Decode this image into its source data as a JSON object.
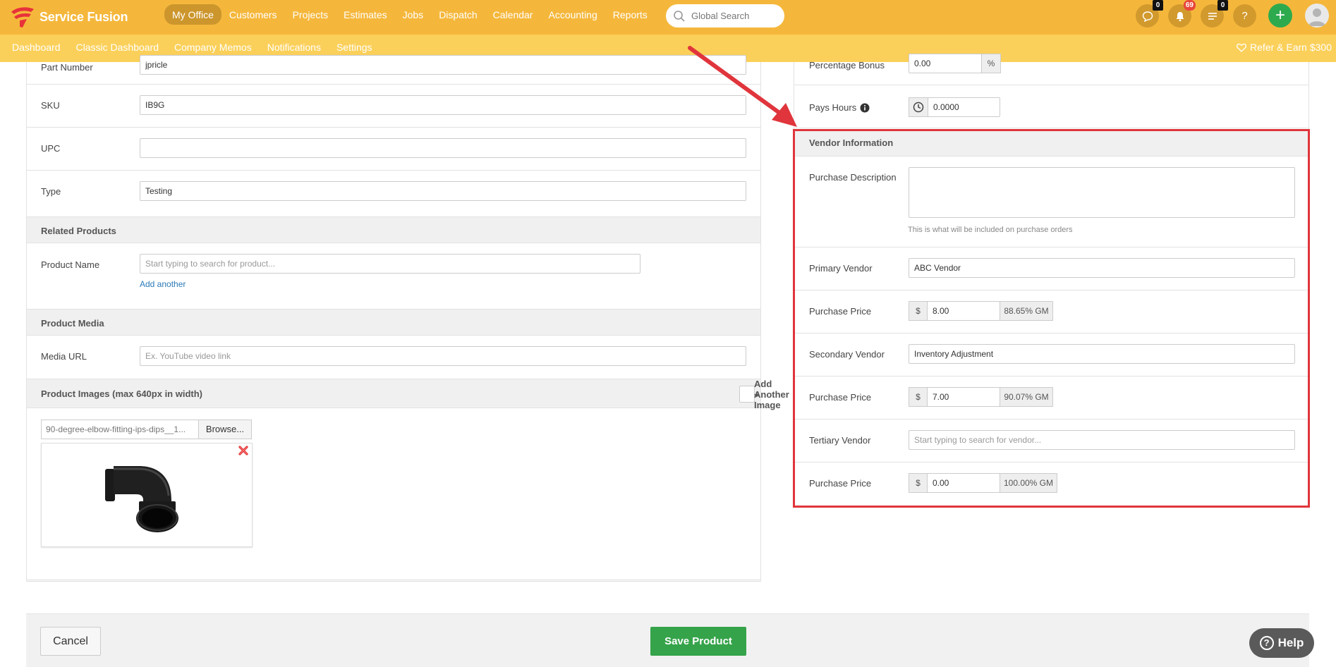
{
  "brand": {
    "name": "Service Fusion"
  },
  "nav": {
    "items": [
      "My Office",
      "Customers",
      "Projects",
      "Estimates",
      "Jobs",
      "Dispatch",
      "Calendar",
      "Accounting",
      "Reports"
    ],
    "active_index": 0
  },
  "search": {
    "placeholder": "Global Search"
  },
  "header_icons": {
    "chat_count": "0",
    "notifications_count": "69",
    "tasks_count": "0",
    "help_symbol": "?",
    "plus_symbol": "+"
  },
  "subnav": {
    "items": [
      "Dashboard",
      "Classic Dashboard",
      "Company Memos",
      "Notifications",
      "Settings"
    ],
    "refer": "Refer & Earn $300"
  },
  "left": {
    "part_number": {
      "label": "Part Number",
      "value": "jpricle"
    },
    "sku": {
      "label": "SKU",
      "value": "IB9G"
    },
    "upc": {
      "label": "UPC",
      "value": ""
    },
    "type": {
      "label": "Type",
      "value": "Testing"
    },
    "related_products": {
      "title": "Related Products",
      "product_name_label": "Product Name",
      "product_name_placeholder": "Start typing to search for product...",
      "add_another": "Add another"
    },
    "product_media": {
      "title": "Product Media",
      "media_url_label": "Media URL",
      "media_url_placeholder": "Ex. YouTube video link"
    },
    "product_images": {
      "title": "Product Images (max 640px in width)",
      "add_button": "Add Another Image",
      "file_name": "90-degree-elbow-fitting-ips-dips__1...",
      "browse": "Browse..."
    }
  },
  "right": {
    "percentage_bonus": {
      "label": "Percentage Bonus",
      "value": "0.00",
      "suffix": "%"
    },
    "pays_hours": {
      "label": "Pays Hours",
      "value": "0.0000"
    },
    "vendor_info": {
      "title": "Vendor Information",
      "purchase_description_label": "Purchase Description",
      "purchase_description_value": "",
      "purchase_description_help": "This is what will be included on purchase orders",
      "primary_vendor_label": "Primary Vendor",
      "primary_vendor_value": "ABC Vendor",
      "primary_price_label": "Purchase Price",
      "primary_price_currency": "$",
      "primary_price_value": "8.00",
      "primary_price_gm": "88.65% GM",
      "secondary_vendor_label": "Secondary Vendor",
      "secondary_vendor_value": "Inventory Adjustment",
      "secondary_price_label": "Purchase Price",
      "secondary_price_currency": "$",
      "secondary_price_value": "7.00",
      "secondary_price_gm": "90.07% GM",
      "tertiary_vendor_label": "Tertiary Vendor",
      "tertiary_vendor_placeholder": "Start typing to search for vendor...",
      "tertiary_price_label": "Purchase Price",
      "tertiary_price_currency": "$",
      "tertiary_price_value": "0.00",
      "tertiary_price_gm": "100.00% GM"
    }
  },
  "footer": {
    "cancel": "Cancel",
    "save": "Save Product"
  },
  "help_widget": {
    "label": "Help"
  },
  "colors": {
    "topbar": "#f5b73b",
    "subbar": "#fbd05a",
    "save": "#35a34a",
    "highlight": "#e0353c",
    "plus": "#2eaa4e"
  }
}
